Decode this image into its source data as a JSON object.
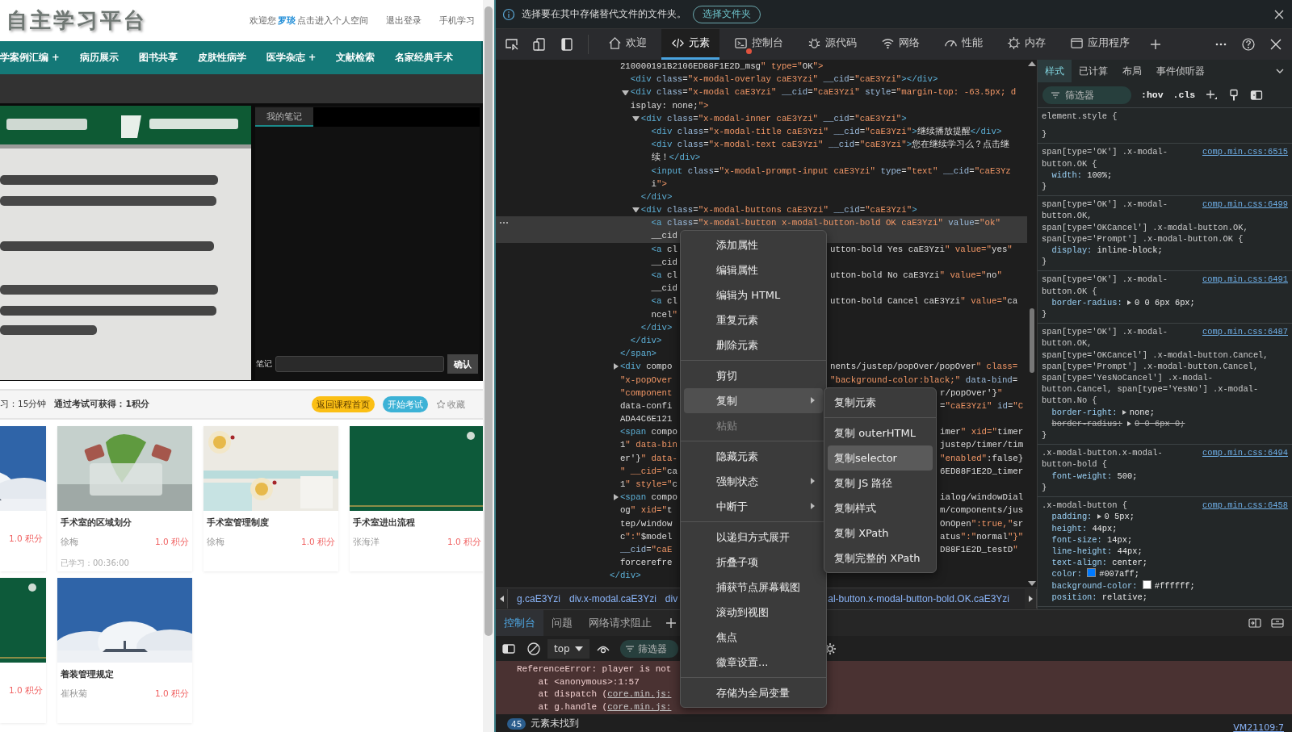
{
  "site": {
    "logo": "自主学习平台",
    "welcome": "欢迎您",
    "user": "罗琰",
    "space_link": "点击进入个人空间",
    "logout": "退出登录",
    "mobile": "手机学习",
    "nav": [
      "学案例汇编 +",
      "病历展示",
      "图书共享",
      "皮肤性病学",
      "医学杂志 +",
      "文献检索",
      "名家经典手术"
    ],
    "notes": {
      "tab": {
        "label": "我的笔记",
        "selected": true
      },
      "label": "笔记",
      "button": "确认"
    },
    "course_bar": {
      "duration": "习：15分钟",
      "reward": "通过考试可获得：1积分",
      "back_button": "返回课程首页",
      "exam_button": "开始考试",
      "favorite": "收藏"
    },
    "cards": [
      {
        "points": "1.0 积分"
      },
      {
        "title": "手术室的区域划分",
        "author": "徐梅",
        "points": "1.0 积分",
        "progress": "已学习：00:36:00"
      },
      {
        "title": "手术室管理制度",
        "author": "徐梅",
        "points": "1.0 积分"
      },
      {
        "title": "手术室进出流程",
        "author": "张海洋",
        "points": "1.0 积分"
      },
      {
        "points": "1.0 积分"
      },
      {
        "title": "着装管理规定",
        "author": "崔秋菊",
        "points": "1.0 积分"
      }
    ]
  },
  "devtools": {
    "infobar": {
      "message": "选择要在其中存储替代文件的文件夹。",
      "button": "选择文件夹"
    },
    "tabs": [
      {
        "label": "欢迎",
        "selected": false,
        "error": false
      },
      {
        "label": "元素",
        "selected": true,
        "error": false
      },
      {
        "label": "控制台",
        "selected": false,
        "error": true
      },
      {
        "label": "源代码",
        "selected": false,
        "error": false
      },
      {
        "label": "网络",
        "selected": false,
        "error": false
      },
      {
        "label": "性能",
        "selected": false,
        "error": false
      },
      {
        "label": "内存",
        "selected": false,
        "error": false
      },
      {
        "label": "应用程序",
        "selected": false,
        "error": false
      }
    ],
    "tree": {
      "close": "</div>",
      "children": [
        {
          "selected": false,
          "lines": [
            {
              "text": "210000191B2106ED88F1E2D_msg\" type=\"OK\">"
            }
          ],
          "close": "</span>",
          "children": [
            {
              "selected": false,
              "lines": [
                {
                  "text": "<div class=\"x-modal-overlay caE3Yzi\" __cid=\"caE3Yzi\"></div>"
                }
              ]
            },
            {
              "expanded": true,
              "selected": false,
              "lines": [
                {
                  "text": "<div class=\"x-modal caE3Yzi\" __cid=\"caE3Yzi\" style=\"margin-top: -63.5px; d"
                },
                {
                  "text": "isplay: none;\">"
                }
              ],
              "close": "</div>",
              "children": [
                {
                  "expanded": true,
                  "selected": false,
                  "lines": [
                    {
                      "text": "<div class=\"x-modal-inner caE3Yzi\" __cid=\"caE3Yzi\">"
                    }
                  ],
                  "close": "</div>",
                  "children": [
                    {
                      "selected": false,
                      "lines": [
                        {
                          "text": "<div class=\"x-modal-title caE3Yzi\" __cid=\"caE3Yzi\">继续播放提醒</div>"
                        }
                      ]
                    },
                    {
                      "selected": false,
                      "lines": [
                        {
                          "text": "<div class=\"x-modal-text caE3Yzi\" __cid=\"caE3Yzi\">您在继续学习么？点击继"
                        },
                        {
                          "text": "续！</div>"
                        }
                      ]
                    },
                    {
                      "selected": false,
                      "lines": [
                        {
                          "text": "<input class=\"x-modal-prompt-input caE3Yzi\" type=\"text\" __cid=\"caE3Yz"
                        },
                        {
                          "text": "i\">"
                        }
                      ]
                    }
                  ]
                },
                {
                  "expanded": true,
                  "selected": false,
                  "lines": [
                    {
                      "text": "<div class=\"x-modal-buttons caE3Yzi\" __cid=\"caE3Yzi\">"
                    }
                  ],
                  "close": "</div>",
                  "children": [
                    {
                      "selected": true,
                      "lines": [
                        {
                          "text": "<a class=\"x-modal-button x-modal-button-bold OK caE3Yzi\" value=\"ok\""
                        },
                        {
                          "text": "__cid"
                        }
                      ]
                    },
                    {
                      "selected": false,
                      "lines": [
                        {
                          "text": "<a cl",
                          "right": "utton-bold Yes caE3Yzi\" value=\"yes\"",
                          "under_submenu": false
                        },
                        {
                          "text": "__cid"
                        }
                      ]
                    },
                    {
                      "selected": false,
                      "lines": [
                        {
                          "text": "<a cl",
                          "right": "utton-bold No caE3Yzi\" value=\"no\"",
                          "under_submenu": false
                        },
                        {
                          "text": "__cid"
                        }
                      ]
                    },
                    {
                      "selected": false,
                      "lines": [
                        {
                          "text": "<a cl",
                          "right": "utton-bold Cancel caE3Yzi\" value=\"ca",
                          "under_submenu": false
                        },
                        {
                          "text": "ncel\""
                        }
                      ]
                    }
                  ]
                }
              ]
            }
          ]
        },
        {
          "expanded": false,
          "selected": false,
          "lines": [
            {
              "text": "<div compo",
              "right": "nents/justep/popOver/popOver\" class=",
              "under_submenu": false
            },
            {
              "text": "\"x-popOver",
              "right": "\"background-color:black;\" data-bind=",
              "under_submenu": false
            },
            {
              "text": "\"component",
              "right": "r/popOver'}\"",
              "under_submenu": true
            },
            {
              "text": "data-confi",
              "right": "=\"caE3Yzi\" id=\"C",
              "under_submenu": true
            },
            {
              "text": "ADA4C6E121"
            }
          ]
        },
        {
          "selected": false,
          "lines": [
            {
              "text": "<span compo",
              "right": "imer\" xid=\"timer",
              "under_submenu": true
            },
            {
              "text": "1\" data-bin",
              "right": "justep/timer/tim",
              "under_submenu": true
            },
            {
              "text": "er'}\" data-",
              "right": "\"enabled\":false}",
              "under_submenu": true
            },
            {
              "text": "\" __cid=\"ca",
              "right": "6ED88F1E2D_timer",
              "under_submenu": true
            },
            {
              "text": "1\" style=\"c"
            }
          ]
        },
        {
          "expanded": false,
          "selected": false,
          "lines": [
            {
              "text": "<span compo",
              "right": "ialog/windowDial",
              "under_submenu": true
            },
            {
              "text": "og\" xid=\"t",
              "right": "m/components/jus",
              "under_submenu": true
            },
            {
              "text": "tep/window",
              "right": "OnOpen\":true,\"sr",
              "under_submenu": true
            },
            {
              "text": "c\":\"$model",
              "right": "atus\":\"normal\"}\"",
              "under_submenu": true
            },
            {
              "text": "__cid=\"caE",
              "right": "D88F1E2D_testD\"",
              "under_submenu": true
            },
            {
              "text": "forcerefre"
            }
          ]
        }
      ]
    },
    "breadcrumb": [
      "g.caE3Yzi",
      "div.x-modal.caE3Yzi",
      "div",
      "al-button.x-modal-button-bold.OK.caE3Yzi"
    ],
    "styles": {
      "tabs": [
        {
          "label": "样式",
          "selected": true
        },
        {
          "label": "已计算",
          "selected": false
        },
        {
          "label": "布局",
          "selected": false
        },
        {
          "label": "事件侦听器",
          "selected": false
        }
      ],
      "filter_placeholder": "筛选器",
      "hov": ":hov",
      "cls": ".cls",
      "rules": [
        {
          "selector": [
            "element.style {"
          ],
          "close": "}"
        },
        {
          "selector": [
            "span[type='OK'] .x-modal-",
            "button.OK {"
          ],
          "link": "comp.min.css:6515",
          "decls": [
            {
              "kind": "plain",
              "name": "width:",
              "value": "100%;",
              "struck": false
            }
          ],
          "close": "}"
        },
        {
          "selector": [
            "span[type='OK'] .x-modal-",
            "button.OK,",
            "span[type='OKCancel'] .x-modal-button.OK,",
            "span[type='Prompt'] .x-modal-button.OK {"
          ],
          "link": "comp.min.css:6499",
          "decls": [
            {
              "kind": "plain",
              "name": "display:",
              "value": "inline-block;",
              "struck": false
            }
          ],
          "close": "}"
        },
        {
          "selector": [
            "span[type='OK'] .x-modal-",
            "button.OK {"
          ],
          "link": "comp.min.css:6491",
          "decls": [
            {
              "kind": "shorthand",
              "name": "border-radius:",
              "value": "0 0 6px 6px;",
              "struck": false
            }
          ],
          "close": "}"
        },
        {
          "selector": [
            "span[type='OK'] .x-modal-",
            "button.OK,",
            "span[type='OKCancel'] .x-modal-button.Cancel,",
            "span[type='Prompt'] .x-modal-button.Cancel,",
            "span[type='YesNoCancel'] .x-modal-",
            "button.Cancel, span[type='YesNo'] .x-modal-",
            "button.No {"
          ],
          "link": "comp.min.css:6487",
          "decls": [
            {
              "kind": "shorthand",
              "name": "border-right:",
              "value": "none;",
              "struck": false
            },
            {
              "kind": "shorthand",
              "name": "border-radius:",
              "value": "0 0 6px 0;",
              "struck": true
            }
          ],
          "close": "}"
        },
        {
          "selector": [
            ".x-modal-button.x-modal-",
            "button-bold {"
          ],
          "link": "comp.min.css:6494",
          "decls": [
            {
              "kind": "plain",
              "name": "font-weight:",
              "value": "500;",
              "struck": false
            }
          ],
          "close": "}"
        },
        {
          "selector": [
            ".x-modal-button {"
          ],
          "link": "comp.min.css:6458",
          "decls": [
            {
              "kind": "shorthand",
              "name": "padding:",
              "value": "0 5px;",
              "struck": false
            },
            {
              "kind": "plain",
              "name": "height:",
              "value": "44px;",
              "struck": false
            },
            {
              "kind": "plain",
              "name": "font-size:",
              "value": "14px;",
              "struck": false
            },
            {
              "kind": "plain",
              "name": "line-height:",
              "value": "44px;",
              "struck": false
            },
            {
              "kind": "plain",
              "name": "text-align:",
              "value": "center;",
              "struck": false
            },
            {
              "kind": "color",
              "name": "color:",
              "value": "#007aff;",
              "color": "#007aff",
              "struck": false
            },
            {
              "kind": "color",
              "name": "background-color:",
              "value": "#ffffff;",
              "color": "#ffffff",
              "struck": false
            },
            {
              "kind": "plain",
              "name": "position:",
              "value": "relative;",
              "struck": false
            }
          ]
        }
      ]
    },
    "drawer": {
      "tabs": [
        {
          "label": "控制台",
          "selected": true
        },
        {
          "label": "问题",
          "selected": false
        },
        {
          "label": "网络请求阻止",
          "selected": false
        }
      ],
      "context": "top",
      "filter_placeholder": "筛选器",
      "messages": [
        {
          "kind": "error",
          "text": "ReferenceError: player is not"
        },
        {
          "kind": "frame",
          "text": "at <anonymous>:1:57"
        },
        {
          "kind": "frame",
          "text": "at dispatch (",
          "link": "core.min.js:"
        },
        {
          "kind": "frame",
          "text": "at g.handle (",
          "link": "core.min.js:"
        }
      ],
      "status": {
        "count": "45",
        "text": "元素未找到"
      },
      "source_link": "VM21109:7"
    },
    "context_menu": {
      "items": [
        {
          "kind": "item",
          "label": "添加属性",
          "selected": false,
          "disabled": false,
          "submenu": false
        },
        {
          "kind": "item",
          "label": "编辑属性",
          "selected": false,
          "disabled": false,
          "submenu": false
        },
        {
          "kind": "item",
          "label": "编辑为 HTML",
          "selected": false,
          "disabled": false,
          "submenu": false
        },
        {
          "kind": "item",
          "label": "重复元素",
          "selected": false,
          "disabled": false,
          "submenu": false
        },
        {
          "kind": "item",
          "label": "删除元素",
          "selected": false,
          "disabled": false,
          "submenu": false
        },
        {
          "kind": "separator"
        },
        {
          "kind": "item",
          "label": "剪切",
          "selected": false,
          "disabled": false,
          "submenu": false
        },
        {
          "kind": "item",
          "label": "复制",
          "selected": true,
          "disabled": false,
          "submenu": true
        },
        {
          "kind": "item",
          "label": "粘贴",
          "selected": false,
          "disabled": true,
          "submenu": false
        },
        {
          "kind": "separator"
        },
        {
          "kind": "item",
          "label": "隐藏元素",
          "selected": false,
          "disabled": false,
          "submenu": false
        },
        {
          "kind": "item",
          "label": "强制状态",
          "selected": false,
          "disabled": false,
          "submenu": true
        },
        {
          "kind": "item",
          "label": "中断于",
          "selected": false,
          "disabled": false,
          "submenu": true
        },
        {
          "kind": "separator"
        },
        {
          "kind": "item",
          "label": "以递归方式展开",
          "selected": false,
          "disabled": false,
          "submenu": false
        },
        {
          "kind": "item",
          "label": "折叠子项",
          "selected": false,
          "disabled": false,
          "submenu": false
        },
        {
          "kind": "item",
          "label": "捕获节点屏幕截图",
          "selected": false,
          "disabled": false,
          "submenu": false
        },
        {
          "kind": "item",
          "label": "滚动到视图",
          "selected": false,
          "disabled": false,
          "submenu": false
        },
        {
          "kind": "item",
          "label": "焦点",
          "selected": false,
          "disabled": false,
          "submenu": false
        },
        {
          "kind": "item",
          "label": "徽章设置...",
          "selected": false,
          "disabled": false,
          "submenu": false
        },
        {
          "kind": "separator"
        },
        {
          "kind": "item",
          "label": "存储为全局变量",
          "selected": false,
          "disabled": false,
          "submenu": false
        }
      ],
      "submenu": [
        {
          "kind": "item",
          "label": "复制元素",
          "selected": false
        },
        {
          "kind": "separator"
        },
        {
          "kind": "item",
          "label": "复制 outerHTML",
          "selected": false
        },
        {
          "kind": "item",
          "label": "复制selector",
          "selected": true
        },
        {
          "kind": "item",
          "label": "复制 JS 路径",
          "selected": false
        },
        {
          "kind": "item",
          "label": "复制样式",
          "selected": false
        },
        {
          "kind": "item",
          "label": "复制 XPath",
          "selected": false
        },
        {
          "kind": "item",
          "label": "复制完整的 XPath",
          "selected": false
        }
      ]
    }
  }
}
